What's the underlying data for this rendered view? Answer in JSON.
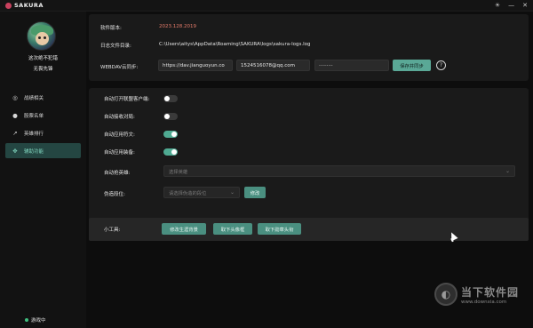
{
  "app": {
    "title": "SAKURA"
  },
  "window_controls": {
    "theme": "☀",
    "minimize": "—",
    "close": "✕"
  },
  "user": {
    "name": "这次绝不犯错",
    "rank": "无畏先锋"
  },
  "nav": {
    "items": [
      {
        "label": "战绩相关",
        "icon": "compass-icon",
        "glyph": "◎"
      },
      {
        "label": "股票名单",
        "icon": "person-icon",
        "glyph": "●"
      },
      {
        "label": "英雄排行",
        "icon": "trend-icon",
        "glyph": "↗"
      },
      {
        "label": "辅助功能",
        "icon": "puzzle-icon",
        "glyph": "✥"
      }
    ],
    "active_index": 3
  },
  "status": {
    "label": "游戏中",
    "color": "#3fbf7f"
  },
  "info": {
    "version_label": "软件版本:",
    "version_value": "2023.128.2019",
    "log_label": "日志文件目录:",
    "log_value": "C:\\Users\\aitys\\AppData\\Roaming\\SAKURA\\logs\\sakura-logs.log",
    "webdav_label": "WEBDAV云同步:",
    "webdav_url": "https://dav.jianguoyun.co",
    "webdav_user": "1524516078@qq.com",
    "webdav_pass": "·········",
    "save_sync_label": "保存并同步",
    "help_glyph": "?"
  },
  "settings": {
    "auto_open_client_label": "自动打开联盟客户端:",
    "auto_open_client_on": false,
    "auto_accept_label": "自动接收对局:",
    "auto_accept_on": false,
    "auto_rune_label": "自动应用符文:",
    "auto_rune_on": true,
    "auto_equip_label": "自动应用装备:",
    "auto_equip_on": true,
    "auto_pick_label": "自动抢英雄:",
    "auto_pick_placeholder": "选择英雄",
    "fake_rank_label": "伪造段位:",
    "fake_rank_placeholder": "请选择伪造的段位",
    "modify_label": "修改",
    "tools_label": "小工具:",
    "tool_change_bg": "修改生涯背景",
    "tool_remove_icon": "取下头像框",
    "tool_remove_banner": "取下勋章头衔"
  },
  "watermark": {
    "title": "当下软件园",
    "url": "www.downxia.com"
  },
  "colors": {
    "accent": "#5aa896",
    "version": "#e47b6a",
    "active_nav_bg": "#244642"
  }
}
